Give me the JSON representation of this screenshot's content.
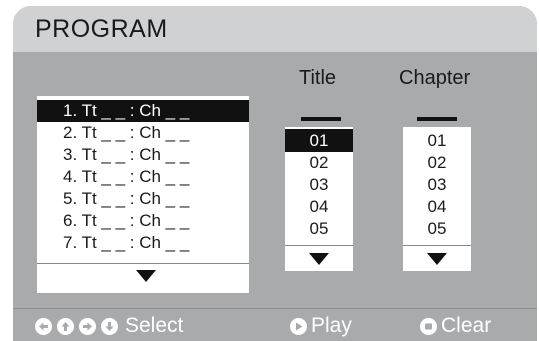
{
  "menu": {
    "title": "PROGRAM"
  },
  "columns": {
    "title_header": "Title",
    "chapter_header": "Chapter"
  },
  "program_list": {
    "items": [
      {
        "label": "1. Tt _ _ : Ch _ _",
        "selected": true
      },
      {
        "label": "2. Tt _ _ : Ch _ _",
        "selected": false
      },
      {
        "label": "3. Tt _ _ : Ch _ _",
        "selected": false
      },
      {
        "label": "4. Tt _ _ : Ch _ _",
        "selected": false
      },
      {
        "label": "5. Tt _ _ : Ch _ _",
        "selected": false
      },
      {
        "label": "6. Tt _ _ : Ch _ _",
        "selected": false
      },
      {
        "label": "7. Tt _ _ : Ch _ _",
        "selected": false
      }
    ]
  },
  "title_list": {
    "value": "",
    "items": [
      "01",
      "02",
      "03",
      "04",
      "05"
    ],
    "selected_index": 0
  },
  "chapter_list": {
    "value": "",
    "items": [
      "01",
      "02",
      "03",
      "04",
      "05"
    ],
    "selected_index": -1
  },
  "help_bar": {
    "select_label": "Select",
    "play_label": "Play",
    "clear_label": "Clear",
    "icons": [
      "left-arrow-icon",
      "up-arrow-icon",
      "right-arrow-icon",
      "down-arrow-icon",
      "play-icon",
      "stop-icon"
    ]
  },
  "colors": {
    "panel_bg": "#a9aaab",
    "title_bar_bg": "#d0d1d2",
    "highlight": "#111111",
    "help_text": "#ffffff"
  }
}
